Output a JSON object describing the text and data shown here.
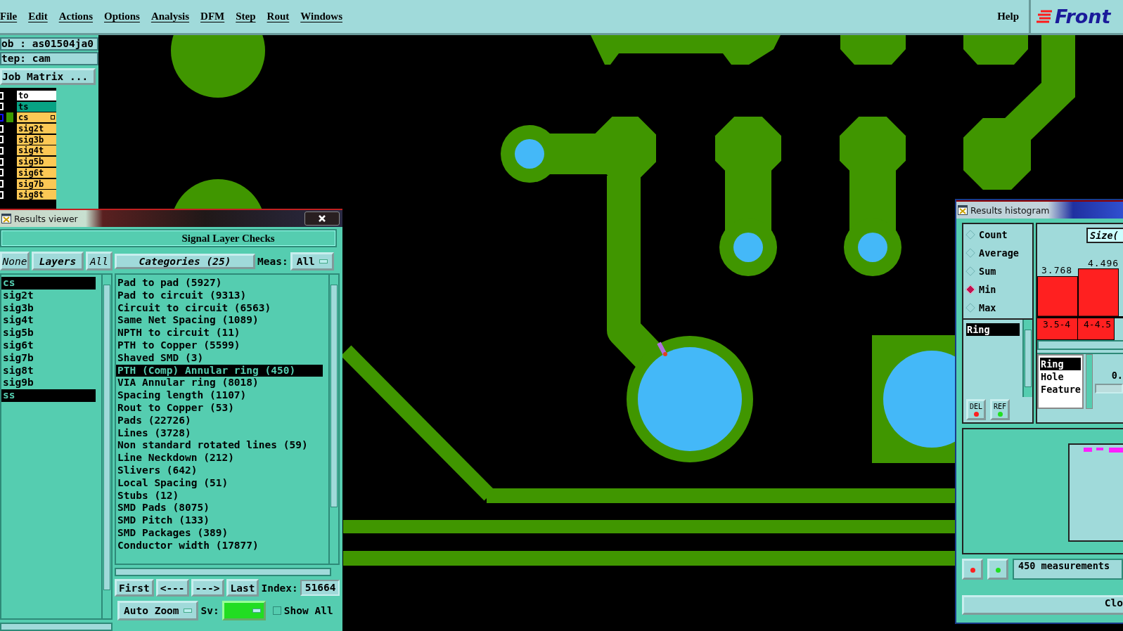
{
  "menu": [
    {
      "label": "File"
    },
    {
      "label": "Edit"
    },
    {
      "label": "Actions"
    },
    {
      "label": "Options"
    },
    {
      "label": "Analysis"
    },
    {
      "label": "DFM"
    },
    {
      "label": "Step"
    },
    {
      "label": "Rout"
    },
    {
      "label": "Windows"
    }
  ],
  "help": "Help",
  "logo": "Front",
  "job": "ob : as01504ja0",
  "step": "tep: cam",
  "job_matrix": "Job Matrix ...",
  "matrix_layers": [
    {
      "name": "to",
      "color": "#ffffff",
      "active": false
    },
    {
      "name": "ts",
      "color": "#07a384",
      "active": false
    },
    {
      "name": "cs",
      "color": "#fcc855",
      "active": true
    },
    {
      "name": "sig2t",
      "color": "#fcc855",
      "active": false
    },
    {
      "name": "sig3b",
      "color": "#fcc855",
      "active": false
    },
    {
      "name": "sig4t",
      "color": "#fcc855",
      "active": false
    },
    {
      "name": "sig5b",
      "color": "#fcc855",
      "active": false
    },
    {
      "name": "sig6t",
      "color": "#fcc855",
      "active": false
    },
    {
      "name": "sig7b",
      "color": "#fcc855",
      "active": false
    },
    {
      "name": "sig8t",
      "color": "#fcc855",
      "active": false
    }
  ],
  "results_viewer": {
    "title": "Results viewer",
    "header": "Signal Layer Checks",
    "layer_buttons": [
      "None",
      "Layers",
      "All"
    ],
    "layers": [
      {
        "name": "cs",
        "selected": true
      },
      {
        "name": "sig2t",
        "selected": false
      },
      {
        "name": "sig3b",
        "selected": false
      },
      {
        "name": "sig4t",
        "selected": false
      },
      {
        "name": "sig5b",
        "selected": false
      },
      {
        "name": "sig6t",
        "selected": false
      },
      {
        "name": "sig7b",
        "selected": false
      },
      {
        "name": "sig8t",
        "selected": false
      },
      {
        "name": "sig9b",
        "selected": false
      },
      {
        "name": "ss",
        "selected": true
      }
    ],
    "categories_button": "Categories (25)",
    "meas_label": "Meas:",
    "meas_value": "All",
    "categories": [
      {
        "label": "Pad to pad (5927)",
        "selected": false
      },
      {
        "label": "Pad to circuit (9313)",
        "selected": false
      },
      {
        "label": "Circuit to circuit (6563)",
        "selected": false
      },
      {
        "label": "Same Net Spacing (1089)",
        "selected": false
      },
      {
        "label": "NPTH to circuit (11)",
        "selected": false
      },
      {
        "label": "PTH to Copper (5599)",
        "selected": false
      },
      {
        "label": "Shaved SMD (3)",
        "selected": false
      },
      {
        "label": "PTH (Comp) Annular ring (450)",
        "selected": true
      },
      {
        "label": "VIA Annular ring (8018)",
        "selected": false
      },
      {
        "label": "Spacing length (1107)",
        "selected": false
      },
      {
        "label": "Rout to Copper (53)",
        "selected": false
      },
      {
        "label": "Pads (22726)",
        "selected": false
      },
      {
        "label": "Lines (3728)",
        "selected": false
      },
      {
        "label": "Non standard rotated lines (59)",
        "selected": false
      },
      {
        "label": "Line Neckdown (212)",
        "selected": false
      },
      {
        "label": "Slivers (642)",
        "selected": false
      },
      {
        "label": "Local Spacing (51)",
        "selected": false
      },
      {
        "label": "Stubs (12)",
        "selected": false
      },
      {
        "label": "SMD Pads (8075)",
        "selected": false
      },
      {
        "label": "SMD Pitch (133)",
        "selected": false
      },
      {
        "label": "SMD Packages (389)",
        "selected": false
      },
      {
        "label": "Conductor width (17877)",
        "selected": false
      }
    ],
    "nav_buttons": [
      "First",
      "<---",
      "--->",
      "Last"
    ],
    "index_label": "Index:",
    "index_value": "51664",
    "zoom_select": "Auto Zoom",
    "sv_label": "Sv:",
    "show_all": {
      "label": "Show All",
      "checked": false
    }
  },
  "histogram": {
    "title": "Results histogram",
    "modes": [
      {
        "label": "Count",
        "selected": false
      },
      {
        "label": "Average",
        "selected": false
      },
      {
        "label": "Sum",
        "selected": false
      },
      {
        "label": "Min",
        "selected": true
      },
      {
        "label": "Max",
        "selected": false
      }
    ],
    "list": [
      {
        "label": "Ring",
        "selected": true
      }
    ],
    "list_buttons": [
      "DEL",
      "REF"
    ],
    "size_label": "Size(",
    "chart_data": {
      "type": "bar",
      "categories": [
        "3.5-4",
        "4-4.5"
      ],
      "values": [
        3.768,
        4.496
      ],
      "data_labels": true
    },
    "fields": [
      {
        "label": "Ring",
        "selected": true
      },
      {
        "label": "Hole",
        "selected": false
      },
      {
        "label": "Feature",
        "selected": false
      }
    ],
    "value": "0.",
    "measurements": "450 measurements",
    "close": "Clo"
  }
}
